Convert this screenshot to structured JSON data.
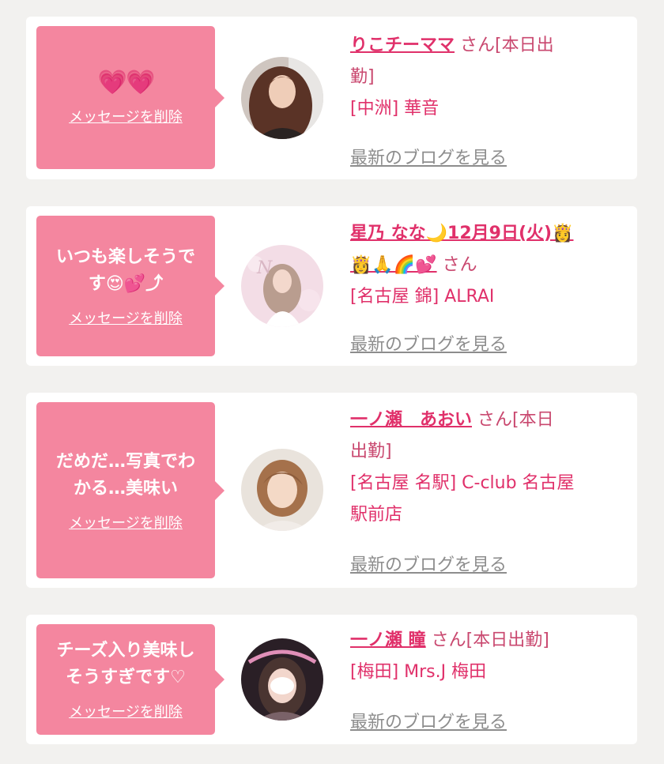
{
  "delete_label": "メッセージを削除",
  "blog_label": "最新のブログを見る",
  "colors": {
    "accent": "#e0306a",
    "bubble": "#f4869f",
    "background": "#f2f1ef"
  },
  "messages": [
    {
      "message": "💗💗",
      "name": "りこチーママ",
      "suffix_line1": " さん[本日出",
      "suffix_line2": "勤]",
      "shop": "[中洲] 華音"
    },
    {
      "message_line1": "いつも楽しそうで",
      "message_line2": "す😍💕⤴",
      "name_line1": "星乃 なな🌙12月9日(火)👸",
      "name_line2": "👸🙏🌈💕",
      "suffix": " さん",
      "shop": "[名古屋 錦] ALRAI"
    },
    {
      "message_line1": "だめだ…写真でわ",
      "message_line2": "かる…美味い",
      "name": "一ノ瀬　あおい",
      "suffix_line1": " さん[本日",
      "suffix_line2": "出勤]",
      "shop_line1": "[名古屋 名駅] C-club 名古屋",
      "shop_line2": "駅前店"
    },
    {
      "message_line1": "チーズ入り美味し",
      "message_line2": "そうすぎです♡",
      "name": "一ノ瀬 瞳",
      "suffix": " さん[本日出勤]",
      "shop": "[梅田] Mrs.J 梅田"
    }
  ]
}
